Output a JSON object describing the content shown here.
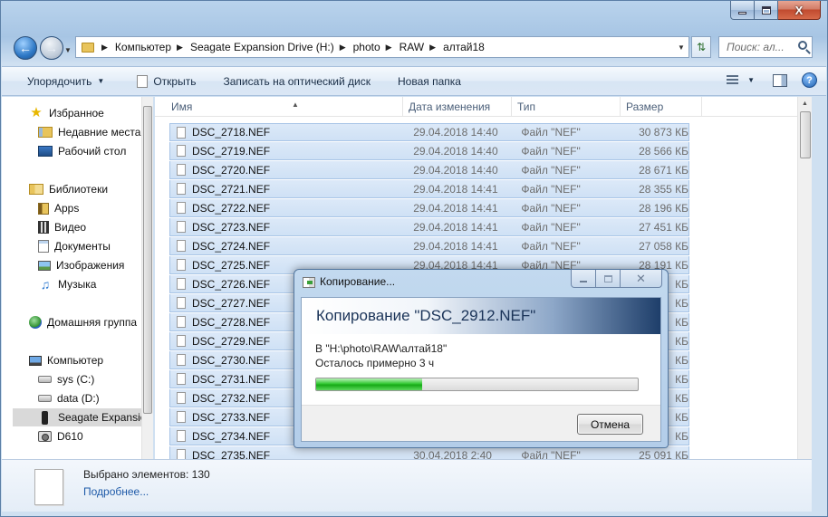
{
  "window": {
    "caption_buttons": {
      "minimize": "",
      "maximize": "",
      "close": "X"
    }
  },
  "navigation": {
    "breadcrumb": [
      "Компьютер",
      "Seagate Expansion Drive (H:)",
      "photo",
      "RAW",
      "алтай18"
    ],
    "search_placeholder": "Поиск: ал..."
  },
  "toolbar": {
    "organize": "Упорядочить",
    "open": "Открыть",
    "burn": "Записать на оптический диск",
    "new_folder": "Новая папка"
  },
  "sidebar": {
    "items": [
      {
        "label": "Избранное",
        "icon": "star-icon"
      },
      {
        "label": "Недавние места",
        "icon": "recent-places-icon"
      },
      {
        "label": "Рабочий стол",
        "icon": "desktop-icon"
      },
      {
        "label": "Библиотеки",
        "icon": "libraries-icon"
      },
      {
        "label": "Apps",
        "icon": "folder-icon"
      },
      {
        "label": "Видео",
        "icon": "video-icon"
      },
      {
        "label": "Документы",
        "icon": "documents-icon"
      },
      {
        "label": "Изображения",
        "icon": "pictures-icon"
      },
      {
        "label": "Музыка",
        "icon": "music-icon"
      },
      {
        "label": "Домашняя группа",
        "icon": "homegroup-icon"
      },
      {
        "label": "Компьютер",
        "icon": "computer-icon"
      },
      {
        "label": "sys (C:)",
        "icon": "drive-icon"
      },
      {
        "label": "data (D:)",
        "icon": "drive-icon"
      },
      {
        "label": "Seagate Expansion",
        "icon": "external-drive-icon"
      },
      {
        "label": "D610",
        "icon": "camera-icon"
      }
    ]
  },
  "columns": {
    "name": "Имя",
    "date": "Дата изменения",
    "type": "Тип",
    "size": "Размер"
  },
  "files": [
    {
      "name": "DSC_2718.NEF",
      "date": "29.04.2018 14:40",
      "type": "Файл \"NEF\"",
      "size": "30 873 КБ"
    },
    {
      "name": "DSC_2719.NEF",
      "date": "29.04.2018 14:40",
      "type": "Файл \"NEF\"",
      "size": "28 566 КБ"
    },
    {
      "name": "DSC_2720.NEF",
      "date": "29.04.2018 14:40",
      "type": "Файл \"NEF\"",
      "size": "28 671 КБ"
    },
    {
      "name": "DSC_2721.NEF",
      "date": "29.04.2018 14:41",
      "type": "Файл \"NEF\"",
      "size": "28 355 КБ"
    },
    {
      "name": "DSC_2722.NEF",
      "date": "29.04.2018 14:41",
      "type": "Файл \"NEF\"",
      "size": "28 196 КБ"
    },
    {
      "name": "DSC_2723.NEF",
      "date": "29.04.2018 14:41",
      "type": "Файл \"NEF\"",
      "size": "27 451 КБ"
    },
    {
      "name": "DSC_2724.NEF",
      "date": "29.04.2018 14:41",
      "type": "Файл \"NEF\"",
      "size": "27 058 КБ"
    },
    {
      "name": "DSC_2725.NEF",
      "date": "29.04.2018 14:41",
      "type": "Файл \"NEF\"",
      "size": "28 191 КБ"
    },
    {
      "name": "DSC_2726.NEF",
      "date": "",
      "type": "",
      "size": "КБ"
    },
    {
      "name": "DSC_2727.NEF",
      "date": "",
      "type": "",
      "size": "КБ"
    },
    {
      "name": "DSC_2728.NEF",
      "date": "",
      "type": "",
      "size": "КБ"
    },
    {
      "name": "DSC_2729.NEF",
      "date": "",
      "type": "",
      "size": "КБ"
    },
    {
      "name": "DSC_2730.NEF",
      "date": "",
      "type": "",
      "size": "КБ"
    },
    {
      "name": "DSC_2731.NEF",
      "date": "",
      "type": "",
      "size": "КБ"
    },
    {
      "name": "DSC_2732.NEF",
      "date": "",
      "type": "",
      "size": "КБ"
    },
    {
      "name": "DSC_2733.NEF",
      "date": "",
      "type": "",
      "size": "КБ"
    },
    {
      "name": "DSC_2734.NEF",
      "date": "",
      "type": "",
      "size": "КБ"
    },
    {
      "name": "DSC_2735.NEF",
      "date": "30.04.2018 2:40",
      "type": "Файл \"NEF\"",
      "size": "25 091 КБ"
    }
  ],
  "details": {
    "count": "Выбрано элементов: 130",
    "more_link": "Подробнее..."
  },
  "copy_dialog": {
    "title": "Копирование...",
    "heading": "Копирование \"DSC_2912.NEF\"",
    "destination": "В \"H:\\photo\\RAW\\алтай18\"",
    "remaining": "Осталось примерно 3 ч",
    "progress_fraction": 0.33,
    "cancel_label": "Отмена",
    "close_glyph": "✕"
  }
}
